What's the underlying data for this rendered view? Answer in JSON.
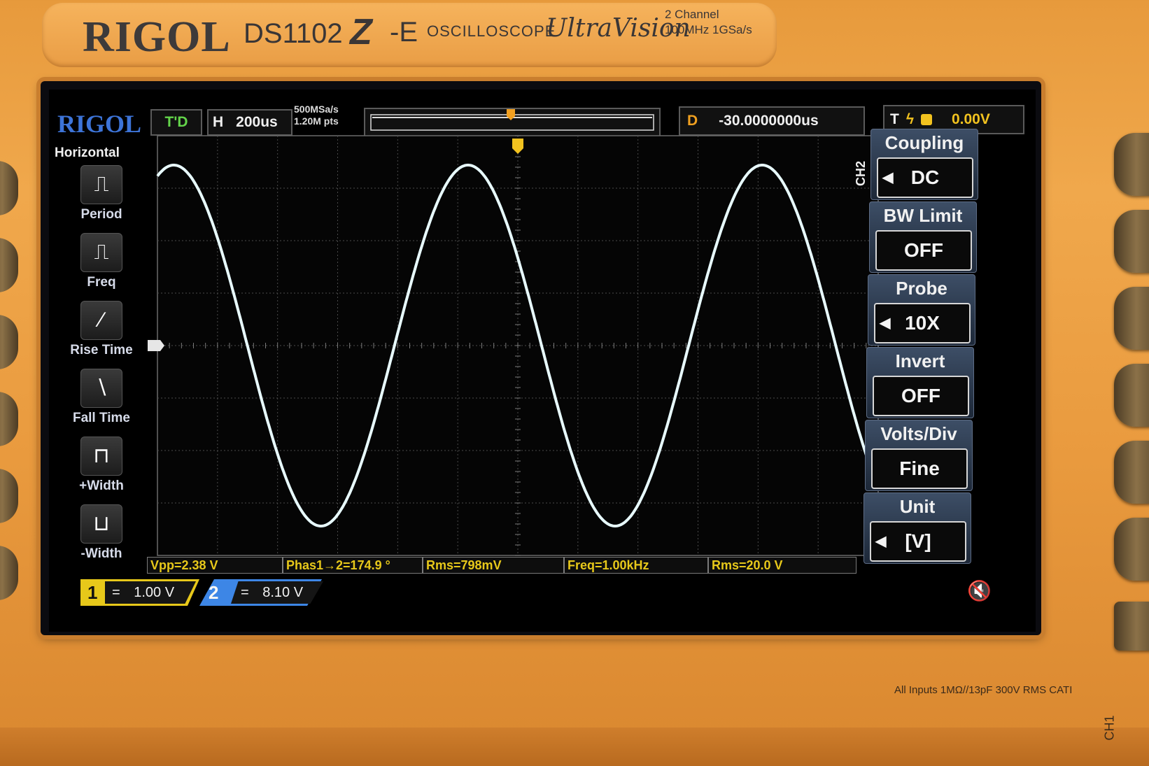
{
  "bezel": {
    "brand": "RIGOL",
    "model": "DS1102",
    "model_suffix": "-E",
    "product_type": "OSCILLOSCOPE",
    "series": "UltraVision",
    "channels_line": "2 Channel",
    "spec_line": "100MHz  1GSa/s",
    "input_rating": "All Inputs 1MΩ//13pF 300V RMS  CATI",
    "ch1_side_label": "CH1"
  },
  "status_bar": {
    "logo": "RIGOL",
    "run_state": "T'D",
    "horizontal_label": "H",
    "timebase": "200us",
    "sample_rate": "500MSa/s",
    "memory_depth": "1.20M pts",
    "delay_label": "D",
    "delay_value": "-30.0000000us",
    "trigger_label": "T",
    "trigger_level": "0.00V"
  },
  "horizontal_menu": {
    "title": "Horizontal",
    "items": [
      {
        "label": "Period",
        "icon": "period-icon",
        "glyph": "⎍"
      },
      {
        "label": "Freq",
        "icon": "freq-icon",
        "glyph": "⎍"
      },
      {
        "label": "Rise Time",
        "icon": "rise-time-icon",
        "glyph": "∕"
      },
      {
        "label": "Fall Time",
        "icon": "fall-time-icon",
        "glyph": "∖"
      },
      {
        "label": "+Width",
        "icon": "positive-width-icon",
        "glyph": "⊓"
      },
      {
        "label": "-Width",
        "icon": "negative-width-icon",
        "glyph": "⊔"
      }
    ]
  },
  "channel_menu": {
    "tag": "CH2",
    "items": [
      {
        "title": "Coupling",
        "value": "DC",
        "has_arrow": true
      },
      {
        "title": "BW Limit",
        "value": "OFF",
        "has_arrow": false
      },
      {
        "title": "Probe",
        "value": "10X",
        "has_arrow": true
      },
      {
        "title": "Invert",
        "value": "OFF",
        "has_arrow": false
      },
      {
        "title": "Volts/Div",
        "value": "Fine",
        "has_arrow": false
      },
      {
        "title": "Unit",
        "value": "[V]",
        "has_arrow": true
      }
    ]
  },
  "measurements": [
    {
      "text": "Vpp=2.38 V"
    },
    {
      "text": "Phas1→2=174.9 °"
    },
    {
      "text": "Rms=798mV"
    },
    {
      "text": "Freq=1.00kHz"
    },
    {
      "text": "Rms=20.0 V"
    }
  ],
  "channels": {
    "ch1": {
      "number": "1",
      "scale": "1.00 V",
      "coupling_symbol": "="
    },
    "ch2": {
      "number": "2",
      "scale": "8.10 V",
      "coupling_symbol": "="
    }
  },
  "trace": {
    "color": "#e8fbff",
    "cycles_visible": 2.45,
    "waveform": "sine"
  },
  "colors": {
    "ch1": "#e7c81a",
    "ch2": "#3d86e6",
    "trigger": "#f2c21f",
    "body": "#e99d45"
  }
}
